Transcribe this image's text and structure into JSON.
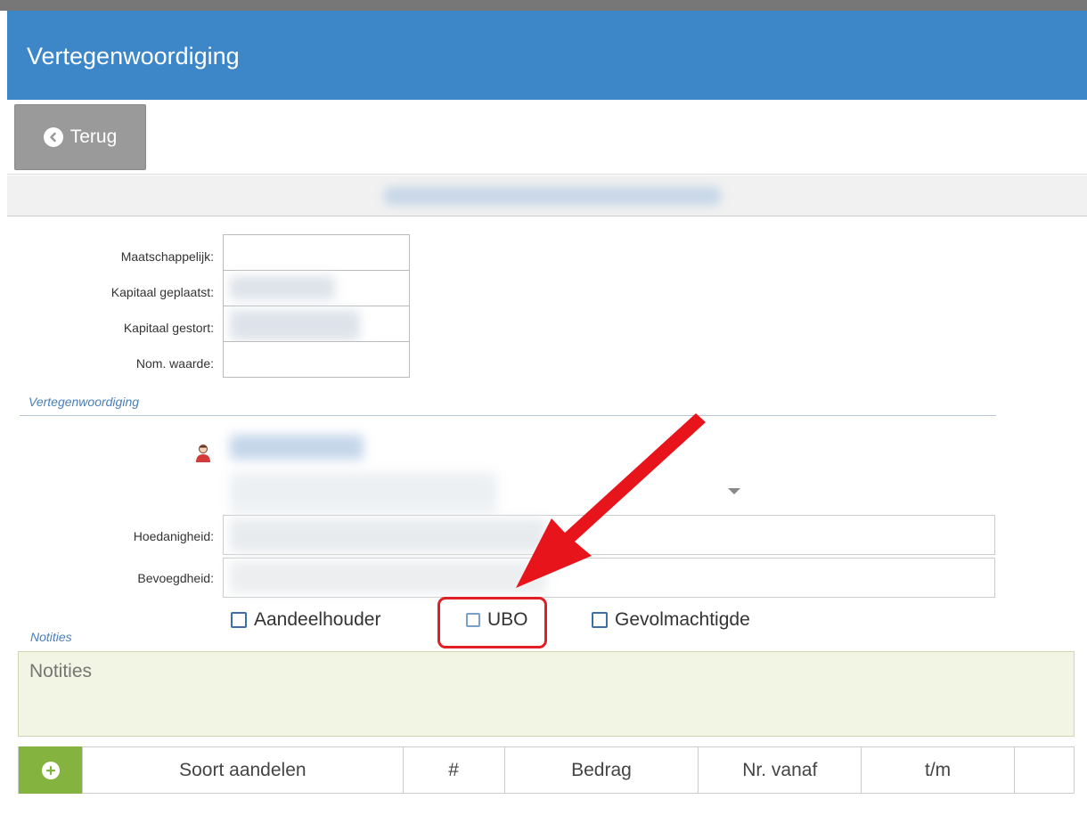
{
  "header": {
    "title": "Vertegenwoordiging"
  },
  "toolbar": {
    "back_label": "Terug"
  },
  "capital_fields": [
    {
      "label": "Maatschappelijk:"
    },
    {
      "label": "Kapitaal geplaatst:"
    },
    {
      "label": "Kapitaal gestort:"
    },
    {
      "label": "Nom. waarde:"
    }
  ],
  "representation": {
    "section_title": "Vertegenwoordiging",
    "capacity_label": "Hoedanigheid:",
    "authority_label": "Bevoegdheid:"
  },
  "checkboxes": [
    {
      "label": "Aandeelhouder",
      "checked": false
    },
    {
      "label": "UBO",
      "checked": false
    },
    {
      "label": "Gevolmachtigde",
      "checked": false
    }
  ],
  "notes": {
    "section_title": "Notities",
    "placeholder": "Notities"
  },
  "shares_table": {
    "columns": [
      "Soort aandelen",
      "#",
      "Bedrag",
      "Nr. vanaf",
      "t/m"
    ]
  },
  "colors": {
    "header_blue": "#3d87c9",
    "add_green": "#84b340",
    "highlight_red": "#e21f26"
  }
}
